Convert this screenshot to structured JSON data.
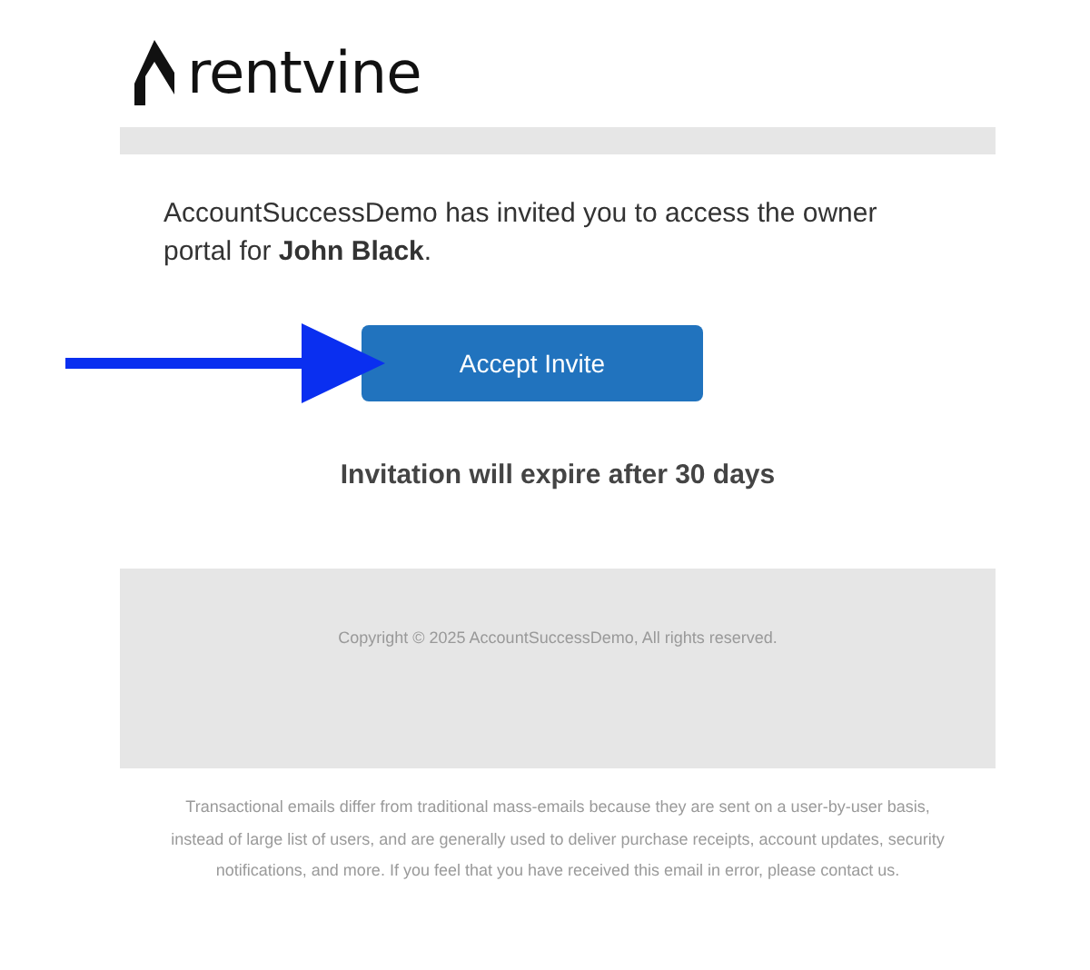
{
  "logo": {
    "text": "rentvine"
  },
  "message": "AccountSuccessDemo has invited you to access the owner portal for **John Black**.",
  "button": {
    "label": "Accept Invite"
  },
  "expiry": "Invitation will expire after 30 days",
  "footer": {
    "copyright": "Copyright © 2025 AccountSuccessDemo, All rights reserved."
  },
  "disclaimer": "Transactional emails differ from traditional mass-emails because they are sent on a user-by-user basis, instead of large list of users, and are generally used to deliver purchase receipts, account updates, security notifications, and more. If you feel that you have received this email in error, please contact us."
}
